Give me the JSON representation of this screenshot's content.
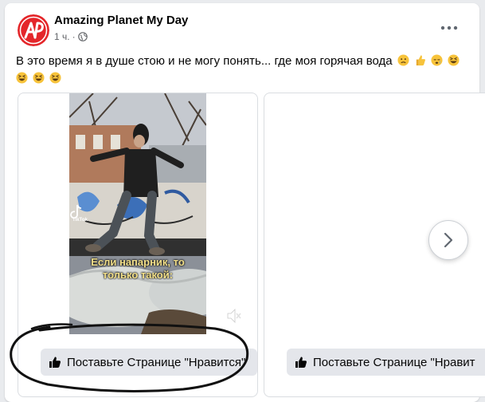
{
  "post": {
    "page_name": "Amazing Planet My Day",
    "time": "1 ч.",
    "separator": "·",
    "privacy_icon": "globe-icon",
    "menu_icon": "more-dots-icon",
    "text": "В это время я в душе стою и не могу понять... где моя горячая вода",
    "emojis": [
      "worried-face",
      "thumbs-up",
      "sleepy-face",
      "grinning-squinting-face",
      "grinning-squinting-face",
      "grinning-squinting-face",
      "grinning-squinting-face"
    ]
  },
  "carousel": {
    "cards": [
      {
        "caption_line1": "Если напарник, то",
        "caption_line2": "только такой:",
        "watermark": "TikTok",
        "like_button_label": "Поставьте Странице \"Нравится\""
      },
      {
        "like_button_label": "Поставьте Странице \"Нравит"
      }
    ],
    "next_icon": "chevron-right-icon"
  },
  "colors": {
    "accent_logo": "#e4262a",
    "button_bg": "#e4e6eb",
    "meta_text": "#65676b"
  }
}
